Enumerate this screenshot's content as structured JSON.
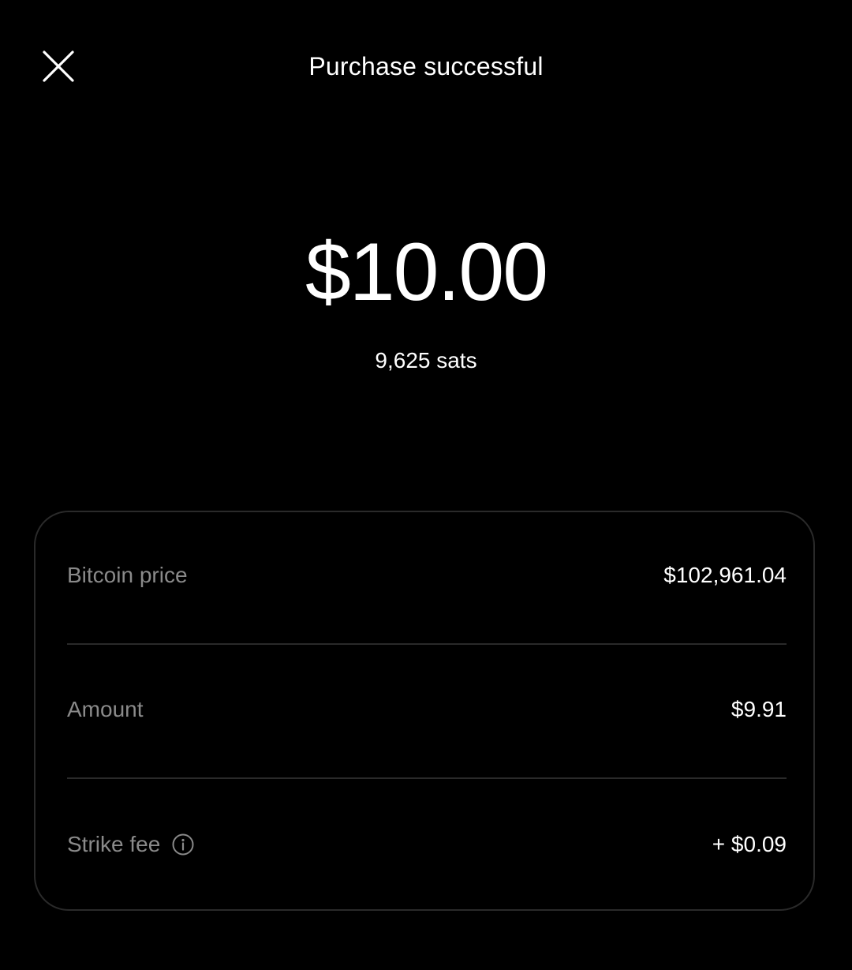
{
  "header": {
    "title": "Purchase successful",
    "close_icon": "close-icon"
  },
  "purchase": {
    "amount": "$10.00",
    "sats": "9,625 sats"
  },
  "details": {
    "rows": [
      {
        "label": "Bitcoin price",
        "value": "$102,961.04"
      },
      {
        "label": "Amount",
        "value": "$9.91"
      },
      {
        "label": "Strike fee",
        "value": "+ $0.09",
        "icon": "info-icon"
      }
    ]
  },
  "colors": {
    "background": "#000000",
    "text": "#ffffff",
    "muted_text": "#8a8a8a",
    "border": "#2a2a2a"
  }
}
